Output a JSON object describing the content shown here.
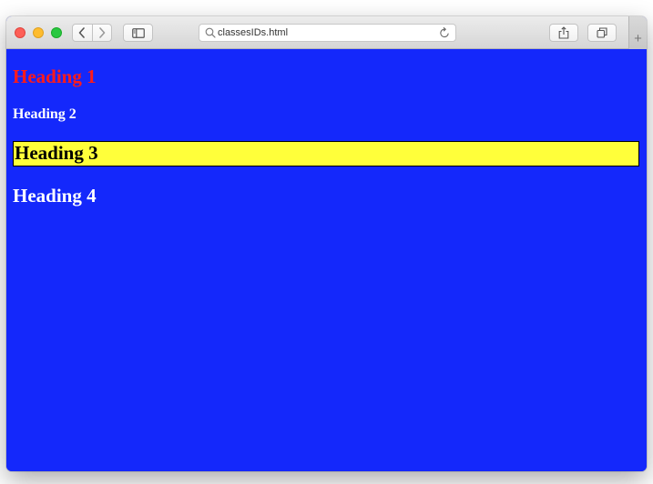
{
  "browser": {
    "address_bar": {
      "url_text": "classesIDs.html"
    },
    "new_tab_label": "+"
  },
  "page": {
    "background_color": "#1428fb",
    "headings": [
      {
        "text": "Heading 1",
        "color": "#ff1b1b"
      },
      {
        "text": "Heading 2",
        "color": "#ffffff"
      },
      {
        "text": "Heading 3",
        "color": "#000000",
        "highlight": "#ffff3a"
      },
      {
        "text": "Heading 4",
        "color": "#ffffff"
      }
    ]
  },
  "icons": {
    "close": "red-traffic-light",
    "minimize": "yellow-traffic-light",
    "zoom": "green-traffic-light",
    "back": "chevron-left-icon",
    "forward": "chevron-right-icon",
    "sidebar": "sidebar-icon",
    "search": "search-icon",
    "reload": "reload-icon",
    "share": "share-icon",
    "tabs": "tabs-overview-icon"
  }
}
